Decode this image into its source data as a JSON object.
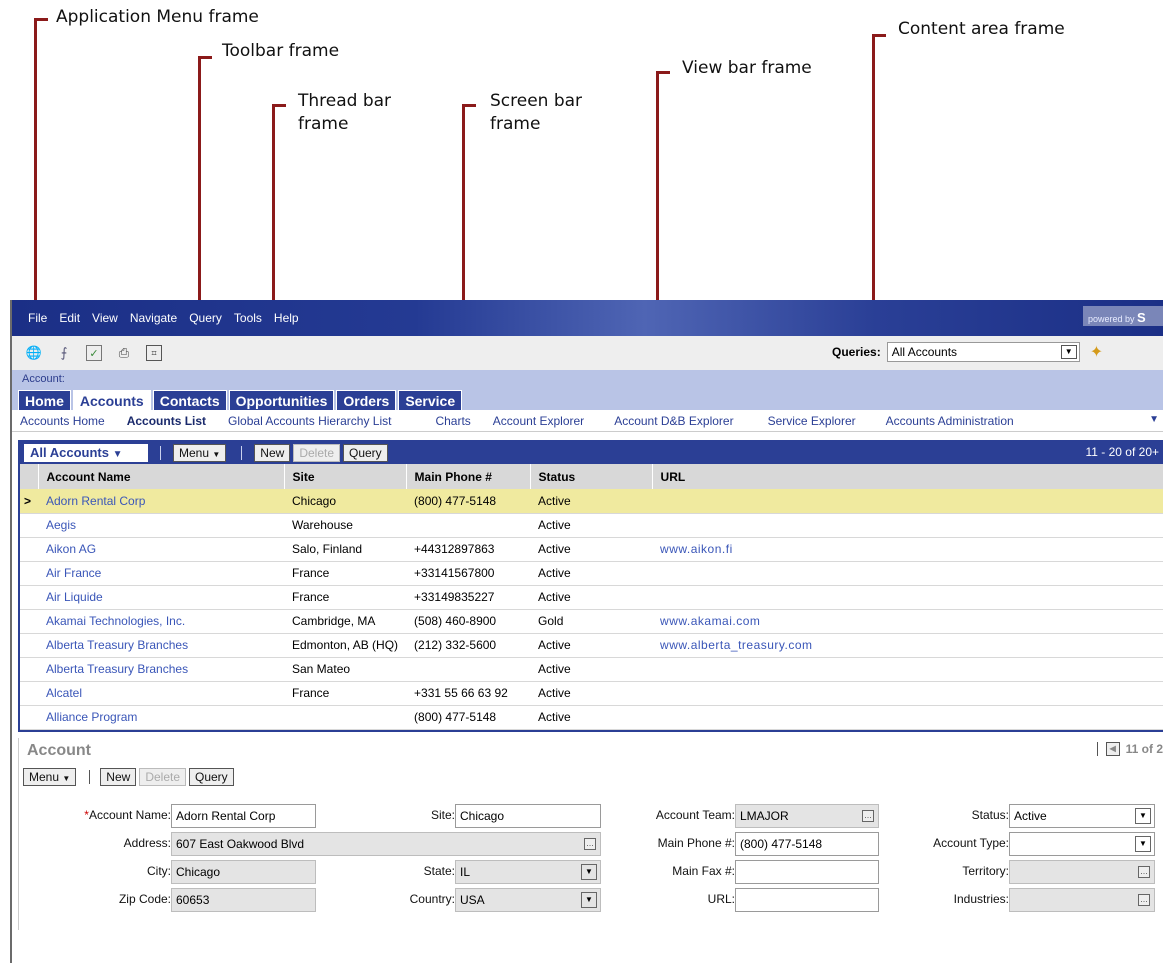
{
  "callouts": {
    "app_menu": "Application Menu frame",
    "toolbar": "Toolbar frame",
    "thread_bar_1": "Thread bar",
    "thread_bar_2": "frame",
    "screen_bar_1": "Screen bar",
    "screen_bar_2": "frame",
    "view_bar": "View bar frame",
    "content_area": "Content area frame"
  },
  "menu": [
    "File",
    "Edit",
    "View",
    "Navigate",
    "Query",
    "Tools",
    "Help"
  ],
  "powered": {
    "prefix": "powered by",
    "brand": "S"
  },
  "toolbar": {
    "icons": [
      "globe-icon",
      "upload-icon",
      "checklist-icon",
      "print-icon",
      "calculator-icon"
    ],
    "queries_label": "Queries:",
    "queries_value": "All Accounts"
  },
  "thread_bar": {
    "text": "Account:"
  },
  "screen_tabs": [
    "Home",
    "Accounts",
    "Contacts",
    "Opportunities",
    "Orders",
    "Service"
  ],
  "active_tab": "Accounts",
  "view_links": [
    "Accounts Home",
    "Accounts List",
    "Global Accounts Hierarchy List",
    "Charts",
    "Account Explorer",
    "Account D&B Explorer",
    "Service Explorer",
    "Accounts Administration"
  ],
  "active_view": "Accounts List",
  "list": {
    "title": "All Accounts",
    "menu_label": "Menu",
    "new_label": "New",
    "delete_label": "Delete",
    "query_label": "Query",
    "page_info": "11 - 20 of 20+",
    "columns": [
      "Account Name",
      "Site",
      "Main Phone #",
      "Status",
      "URL"
    ],
    "rows": [
      [
        "Adorn Rental Corp",
        "Chicago",
        "(800) 477-5148",
        "Active",
        ""
      ],
      [
        "Aegis",
        "Warehouse",
        "",
        "Active",
        ""
      ],
      [
        "Aikon AG",
        "Salo, Finland",
        "+44312897863",
        "Active",
        "www.aikon.fi"
      ],
      [
        "Air France",
        "France",
        "+33141567800",
        "Active",
        ""
      ],
      [
        "Air Liquide",
        "France",
        "+33149835227",
        "Active",
        ""
      ],
      [
        "Akamai Technologies, Inc.",
        "Cambridge, MA",
        "(508) 460-8900",
        "Gold",
        "www.akamai.com"
      ],
      [
        "Alberta Treasury Branches",
        "Edmonton, AB (HQ)",
        "(212) 332-5600",
        "Active",
        "www.alberta_treasury.com"
      ],
      [
        "Alberta Treasury Branches",
        "San Mateo",
        "",
        "Active",
        ""
      ],
      [
        "Alcatel",
        "France",
        "+331 55 66 63 92",
        "Active",
        ""
      ],
      [
        "Alliance Program",
        "",
        "(800) 477-5148",
        "Active",
        ""
      ]
    ],
    "selected_marker": ">"
  },
  "form": {
    "title": "Account",
    "record_info": "11 of 2",
    "menu_label": "Menu",
    "new_label": "New",
    "delete_label": "Delete",
    "query_label": "Query",
    "required_mark": "*",
    "fields": {
      "account_name": {
        "label": "Account Name:",
        "value": "Adorn Rental Corp"
      },
      "site": {
        "label": "Site:",
        "value": "Chicago"
      },
      "account_team": {
        "label": "Account Team:",
        "value": "LMAJOR"
      },
      "status": {
        "label": "Status:",
        "value": "Active"
      },
      "address": {
        "label": "Address:",
        "value": "607 East Oakwood Blvd"
      },
      "main_phone": {
        "label": "Main Phone #:",
        "value": "(800) 477-5148"
      },
      "account_type": {
        "label": "Account Type:",
        "value": ""
      },
      "city": {
        "label": "City:",
        "value": "Chicago"
      },
      "state": {
        "label": "State:",
        "value": "IL"
      },
      "main_fax": {
        "label": "Main Fax #:",
        "value": ""
      },
      "territory": {
        "label": "Territory:",
        "value": ""
      },
      "zip": {
        "label": "Zip Code:",
        "value": "60653"
      },
      "country": {
        "label": "Country:",
        "value": "USA"
      },
      "url": {
        "label": "URL:",
        "value": ""
      },
      "industries": {
        "label": "Industries:",
        "value": ""
      }
    }
  }
}
